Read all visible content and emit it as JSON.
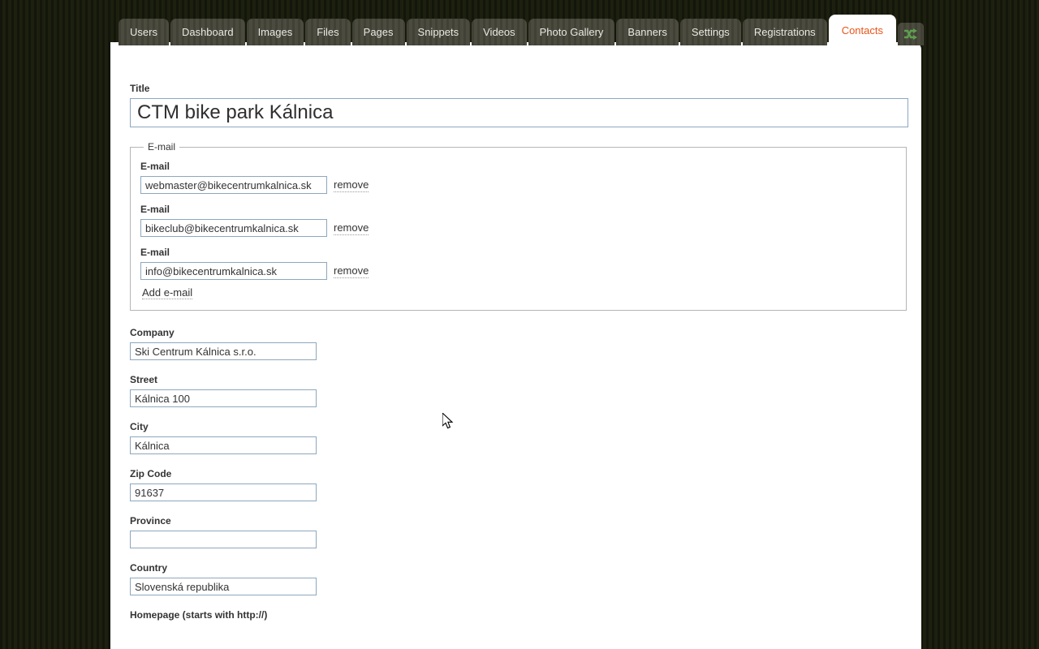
{
  "tabs": [
    {
      "label": "Users",
      "active": false
    },
    {
      "label": "Dashboard",
      "active": false
    },
    {
      "label": "Images",
      "active": false
    },
    {
      "label": "Files",
      "active": false
    },
    {
      "label": "Pages",
      "active": false
    },
    {
      "label": "Snippets",
      "active": false
    },
    {
      "label": "Videos",
      "active": false
    },
    {
      "label": "Photo Gallery",
      "active": false
    },
    {
      "label": "Banners",
      "active": false
    },
    {
      "label": "Settings",
      "active": false
    },
    {
      "label": "Registrations",
      "active": false
    },
    {
      "label": "Contacts",
      "active": true
    }
  ],
  "tab_icon": {
    "name": "shuffle-icon",
    "color": "#5f9e4f"
  },
  "form": {
    "title": {
      "label": "Title",
      "value": "CTM bike park Kálnica"
    },
    "emails": {
      "legend": "E-mail",
      "item_label": "E-mail",
      "remove_label": "remove",
      "add_label": "Add e-mail",
      "items": [
        {
          "value": "webmaster@bikecentrumkalnica.sk"
        },
        {
          "value": "bikeclub@bikecentrumkalnica.sk"
        },
        {
          "value": "info@bikecentrumkalnica.sk"
        }
      ]
    },
    "fields": [
      {
        "label": "Company",
        "value": "Ski Centrum Kálnica s.r.o.",
        "placeholder": ""
      },
      {
        "label": "Street",
        "value": "Kálnica 100",
        "placeholder": ""
      },
      {
        "label": "City",
        "value": "Kálnica",
        "placeholder": ""
      },
      {
        "label": "Zip Code",
        "value": "91637",
        "placeholder": ""
      },
      {
        "label": "Province",
        "value": "",
        "placeholder": ""
      },
      {
        "label": "Country",
        "value": "Slovenská republika",
        "placeholder": ""
      }
    ],
    "homepage": {
      "label": "Homepage (starts with http://)"
    }
  },
  "colors": {
    "page_background": "#171a0b",
    "tab_background": "#45453a",
    "active_tab_text": "#e8551a",
    "panel": "#ffffff",
    "input_border": "#8ea7bd"
  }
}
